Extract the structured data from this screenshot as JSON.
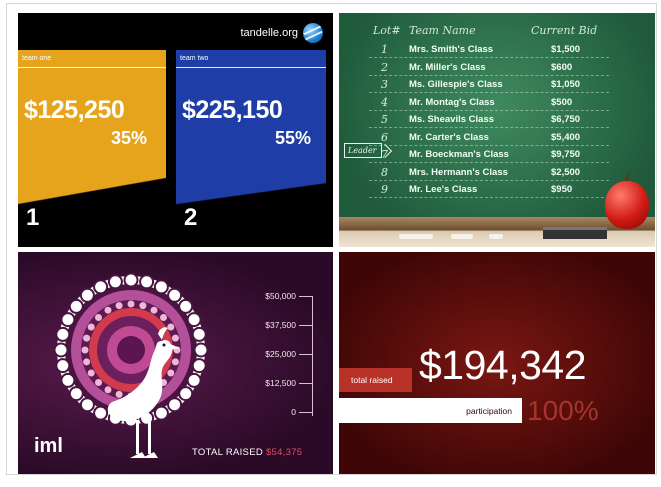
{
  "panels": {
    "teams": {
      "brand": "tandelle.org",
      "team_one": {
        "label": "team one",
        "amount": "$125,250",
        "percent": "35%",
        "rank": "1"
      },
      "team_two": {
        "label": "team two",
        "amount": "$225,150",
        "percent": "55%",
        "rank": "2"
      },
      "colors": {
        "team_one": "#e6a41d",
        "team_two": "#1f3da6"
      }
    },
    "chalkboard": {
      "headers": {
        "lot": "Lot#",
        "team": "Team Name",
        "bid": "Current Bid"
      },
      "leader_label": "Leader",
      "rows": [
        {
          "num": "1",
          "name": "Mrs. Smith's Class",
          "bid": "$1,500"
        },
        {
          "num": "2",
          "name": "Mr. Miller's Class",
          "bid": "$600"
        },
        {
          "num": "3",
          "name": "Ms. Gillespie's Class",
          "bid": "$1,050"
        },
        {
          "num": "4",
          "name": "Mr. Montag's Class",
          "bid": "$500"
        },
        {
          "num": "5",
          "name": "Ms. Sheavils Class",
          "bid": "$6,750"
        },
        {
          "num": "6",
          "name": "Mr. Carter's Class",
          "bid": "$5,400"
        },
        {
          "num": "7",
          "name": "Mr. Boeckman's Class",
          "bid": "$9,750"
        },
        {
          "num": "8",
          "name": "Mrs. Hermann's Class",
          "bid": "$2,500"
        },
        {
          "num": "9",
          "name": "Mr. Lee's Class",
          "bid": "$950"
        }
      ]
    },
    "iml": {
      "logo": "iml",
      "scale": [
        "$50,000",
        "$37,500",
        "$25,000",
        "$12,500",
        "0"
      ],
      "total_label": "TOTAL RAISED",
      "total_value": "$54,375",
      "accent": "#e84b5e"
    },
    "summary": {
      "total_label": "total raised",
      "total_value": "$194,342",
      "participation_label": "participation",
      "participation_value": "100%"
    }
  }
}
